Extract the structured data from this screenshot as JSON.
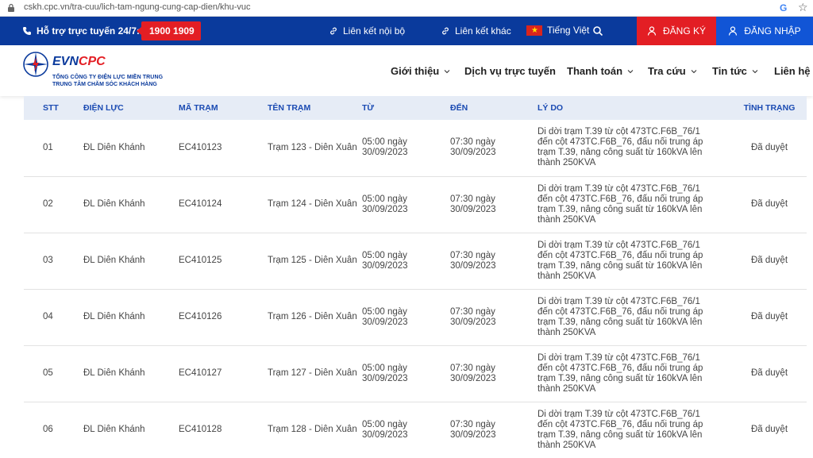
{
  "browser": {
    "url": "cskh.cpc.vn/tra-cuu/lich-tam-ngung-cung-cap-dien/khu-vuc",
    "google_icon": "G"
  },
  "topbar": {
    "support_label": "Hỗ trợ trực tuyến 24/7:",
    "hotline": "1900 1909",
    "internal_link": "Liên kết nội bộ",
    "other_link": "Liên kết khác",
    "language": "Tiếng Việt",
    "register": "ĐĂNG KÝ",
    "login": "ĐĂNG NHẬP",
    "colors": {
      "primary": "#0a3a9c",
      "accent": "#e31e24",
      "login_bg": "#1155d6"
    }
  },
  "header": {
    "logo_evn": "EVN",
    "logo_cpc": "CPC",
    "logo_sub1": "TỔNG CÔNG TY ĐIỆN LỰC MIỀN TRUNG",
    "logo_sub2": "TRUNG TÂM CHĂM SÓC KHÁCH HÀNG",
    "nav": [
      {
        "label": "Giới thiệu",
        "has_dropdown": true
      },
      {
        "label": "Dịch vụ trực tuyến",
        "has_dropdown": false
      },
      {
        "label": "Thanh toán",
        "has_dropdown": true
      },
      {
        "label": "Tra cứu",
        "has_dropdown": true
      },
      {
        "label": "Tin tức",
        "has_dropdown": true
      },
      {
        "label": "Liên hệ",
        "has_dropdown": false
      }
    ]
  },
  "table": {
    "headers": [
      "STT",
      "ĐIỆN LỰC",
      "MÃ TRẠM",
      "TÊN TRẠM",
      "TỪ",
      "ĐẾN",
      "LÝ DO",
      "TÌNH TRẠNG"
    ],
    "rows": [
      {
        "stt": "01",
        "dien_luc": "ĐL Diên Khánh",
        "ma_tram": "EC410123",
        "ten_tram": "Trạm 123 - Diên Xuân",
        "tu": "05:00 ngày 30/09/2023",
        "den": "07:30 ngày 30/09/2023",
        "ly_do": "Di dời trạm T.39 từ cột 473TC.F6B_76/1 đến cột 473TC.F6B_76, đấu nối trung áp trạm T.39, nâng công suất từ 160kVA lên thành 250KVA",
        "tinh_trang": "Đã duyệt"
      },
      {
        "stt": "02",
        "dien_luc": "ĐL Diên Khánh",
        "ma_tram": "EC410124",
        "ten_tram": "Trạm 124 - Diên Xuân",
        "tu": "05:00 ngày 30/09/2023",
        "den": "07:30 ngày 30/09/2023",
        "ly_do": "Di dời trạm T.39 từ cột 473TC.F6B_76/1 đến cột 473TC.F6B_76, đấu nối trung áp trạm T.39, nâng công suất từ 160kVA lên thành 250KVA",
        "tinh_trang": "Đã duyệt"
      },
      {
        "stt": "03",
        "dien_luc": "ĐL Diên Khánh",
        "ma_tram": "EC410125",
        "ten_tram": "Trạm 125 - Diên Xuân",
        "tu": "05:00 ngày 30/09/2023",
        "den": "07:30 ngày 30/09/2023",
        "ly_do": "Di dời trạm T.39 từ cột 473TC.F6B_76/1 đến cột 473TC.F6B_76, đấu nối trung áp trạm T.39, nâng công suất từ 160kVA lên thành 250KVA",
        "tinh_trang": "Đã duyệt"
      },
      {
        "stt": "04",
        "dien_luc": "ĐL Diên Khánh",
        "ma_tram": "EC410126",
        "ten_tram": "Trạm 126 - Diên Xuân",
        "tu": "05:00 ngày 30/09/2023",
        "den": "07:30 ngày 30/09/2023",
        "ly_do": "Di dời trạm T.39 từ cột 473TC.F6B_76/1 đến cột 473TC.F6B_76, đấu nối trung áp trạm T.39, nâng công suất từ 160kVA lên thành 250KVA",
        "tinh_trang": "Đã duyệt"
      },
      {
        "stt": "05",
        "dien_luc": "ĐL Diên Khánh",
        "ma_tram": "EC410127",
        "ten_tram": "Trạm 127 - Diên Xuân",
        "tu": "05:00 ngày 30/09/2023",
        "den": "07:30 ngày 30/09/2023",
        "ly_do": "Di dời trạm T.39 từ cột 473TC.F6B_76/1 đến cột 473TC.F6B_76, đấu nối trung áp trạm T.39, nâng công suất từ 160kVA lên thành 250KVA",
        "tinh_trang": "Đã duyệt"
      },
      {
        "stt": "06",
        "dien_luc": "ĐL Diên Khánh",
        "ma_tram": "EC410128",
        "ten_tram": "Trạm 128 - Diên Xuân",
        "tu": "05:00 ngày 30/09/2023",
        "den": "07:30 ngày 30/09/2023",
        "ly_do": "Di dời trạm T.39 từ cột 473TC.F6B_76/1 đến cột 473TC.F6B_76, đấu nối trung áp trạm T.39, nâng công suất từ 160kVA lên thành 250KVA",
        "tinh_trang": "Đã duyệt"
      }
    ]
  }
}
